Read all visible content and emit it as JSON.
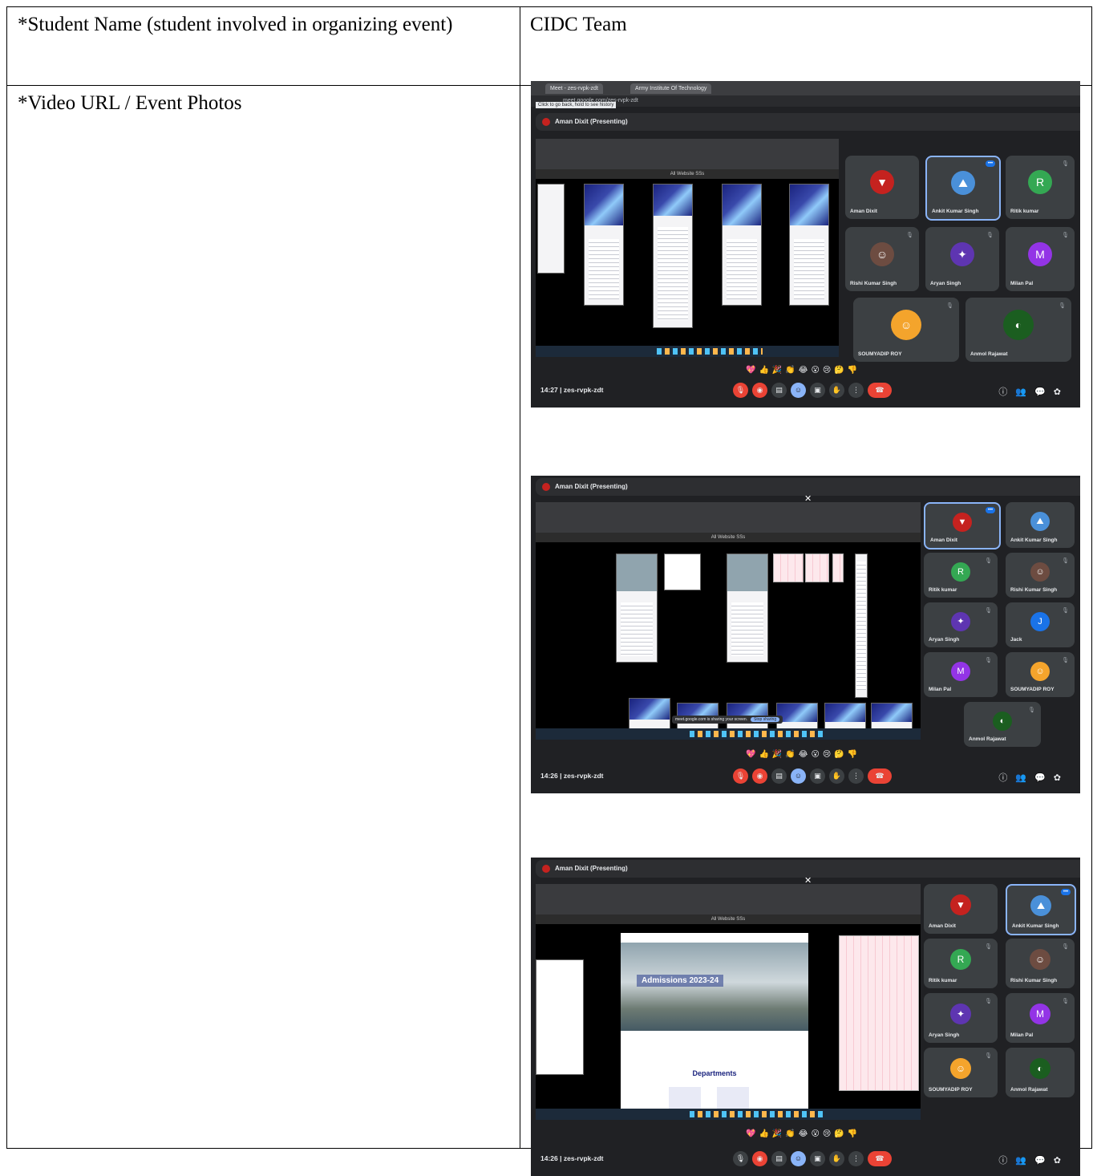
{
  "table": {
    "row1_label": "*Student Name (student involved in organizing event)",
    "row1_value": "CIDC Team",
    "row2_label": "*Video URL  / Event Photos"
  },
  "photos": [
    {
      "browser_tabs": [
        "Meet - zes-rvpk-zdt",
        "Army Institute Of Technology"
      ],
      "url": "meet.google.com/zes-rvpk-zdt",
      "tooltip": "Click to go back, hold to see history",
      "presenting": "Aman Dixit (Presenting)",
      "figma_title": "All Website SSs",
      "participants": [
        "Aman Dixit",
        "Ankit Kumar Singh",
        "Ritik kumar",
        "Rishi Kumar Singh",
        "Aryan Singh",
        "Milan Pal",
        "SOUMYADIP ROY",
        "Anmol Rajawat"
      ],
      "time": "14:27",
      "meeting_code": "zes-rvpk-zdt"
    },
    {
      "presenting": "Aman Dixit (Presenting)",
      "figma_title": "All Website SSs",
      "share_banner": "meet.google.com is sharing your screen.",
      "stop_label": "Stop sharing",
      "participants": [
        "Aman Dixit",
        "Ankit Kumar Singh",
        "Ritik kumar",
        "Rishi Kumar Singh",
        "Aryan Singh",
        "Jack",
        "Milan Pal",
        "SOUMYADIP ROY",
        "Anmol Rajawat"
      ],
      "time": "14:26",
      "meeting_code": "zes-rvpk-zdt"
    },
    {
      "presenting": "Aman Dixit (Presenting)",
      "figma_title": "All Website SSs",
      "site_banner": "Admissions 2023-24",
      "site_section": "Departments",
      "participants": [
        "Aman Dixit",
        "Ankit Kumar Singh",
        "Ritik kumar",
        "Rishi Kumar Singh",
        "Aryan Singh",
        "Milan Pal",
        "SOUMYADIP ROY",
        "Anmol Rajawat"
      ],
      "time": "14:26",
      "meeting_code": "zes-rvpk-zdt"
    }
  ],
  "avatars": {
    "Ritik kumar": "R",
    "Milan Pal": "M",
    "Jack": "J"
  },
  "colors": {
    "meet_bg": "#202124",
    "tile_bg": "#3c4043",
    "active_border": "#8ab4f8",
    "end_call": "#ea4335",
    "ritik_avatar": "#34a853",
    "milan_avatar": "#9334e6",
    "jack_avatar": "#1a73e8",
    "aman_avatar": "#c5221f"
  },
  "reaction_icons": "💖👍🎉👏😂😮😢🤔👎",
  "separator": "|"
}
